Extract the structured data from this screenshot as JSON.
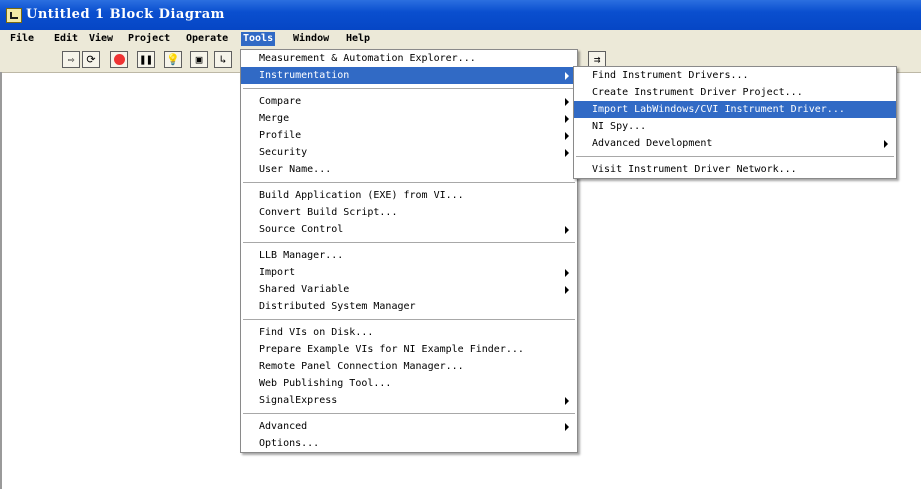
{
  "window": {
    "title": "Untitled 1 Block Diagram"
  },
  "menubar": [
    "File",
    "Edit",
    "View",
    "Project",
    "Operate",
    "Tools",
    "Window",
    "Help"
  ],
  "tools_menu": [
    "Measurement & Automation Explorer...",
    "Instrumentation",
    "Compare",
    "Merge",
    "Profile",
    "Security",
    "User Name...",
    "Build Application (EXE) from VI...",
    "Convert Build Script...",
    "Source Control",
    "LLB Manager...",
    "Import",
    "Shared Variable",
    "Distributed System Manager",
    "Find VIs on Disk...",
    "Prepare Example VIs for NI Example Finder...",
    "Remote Panel Connection Manager...",
    "Web Publishing Tool...",
    "SignalExpress",
    "Advanced",
    "Options..."
  ],
  "instrumentation_menu": [
    "Find Instrument Drivers...",
    "Create Instrument Driver Project...",
    "Import LabWindows/CVI Instrument Driver...",
    "NI Spy...",
    "Advanced Development",
    "Visit Instrument Driver Network..."
  ],
  "toolbar_icons": [
    "run-arrow-icon",
    "run-continuously-icon",
    "abort-icon",
    "pause-icon",
    "highlight-execution-icon",
    "retain-wire-values-icon",
    "step-into-icon",
    "clean-up-diagram-icon"
  ]
}
